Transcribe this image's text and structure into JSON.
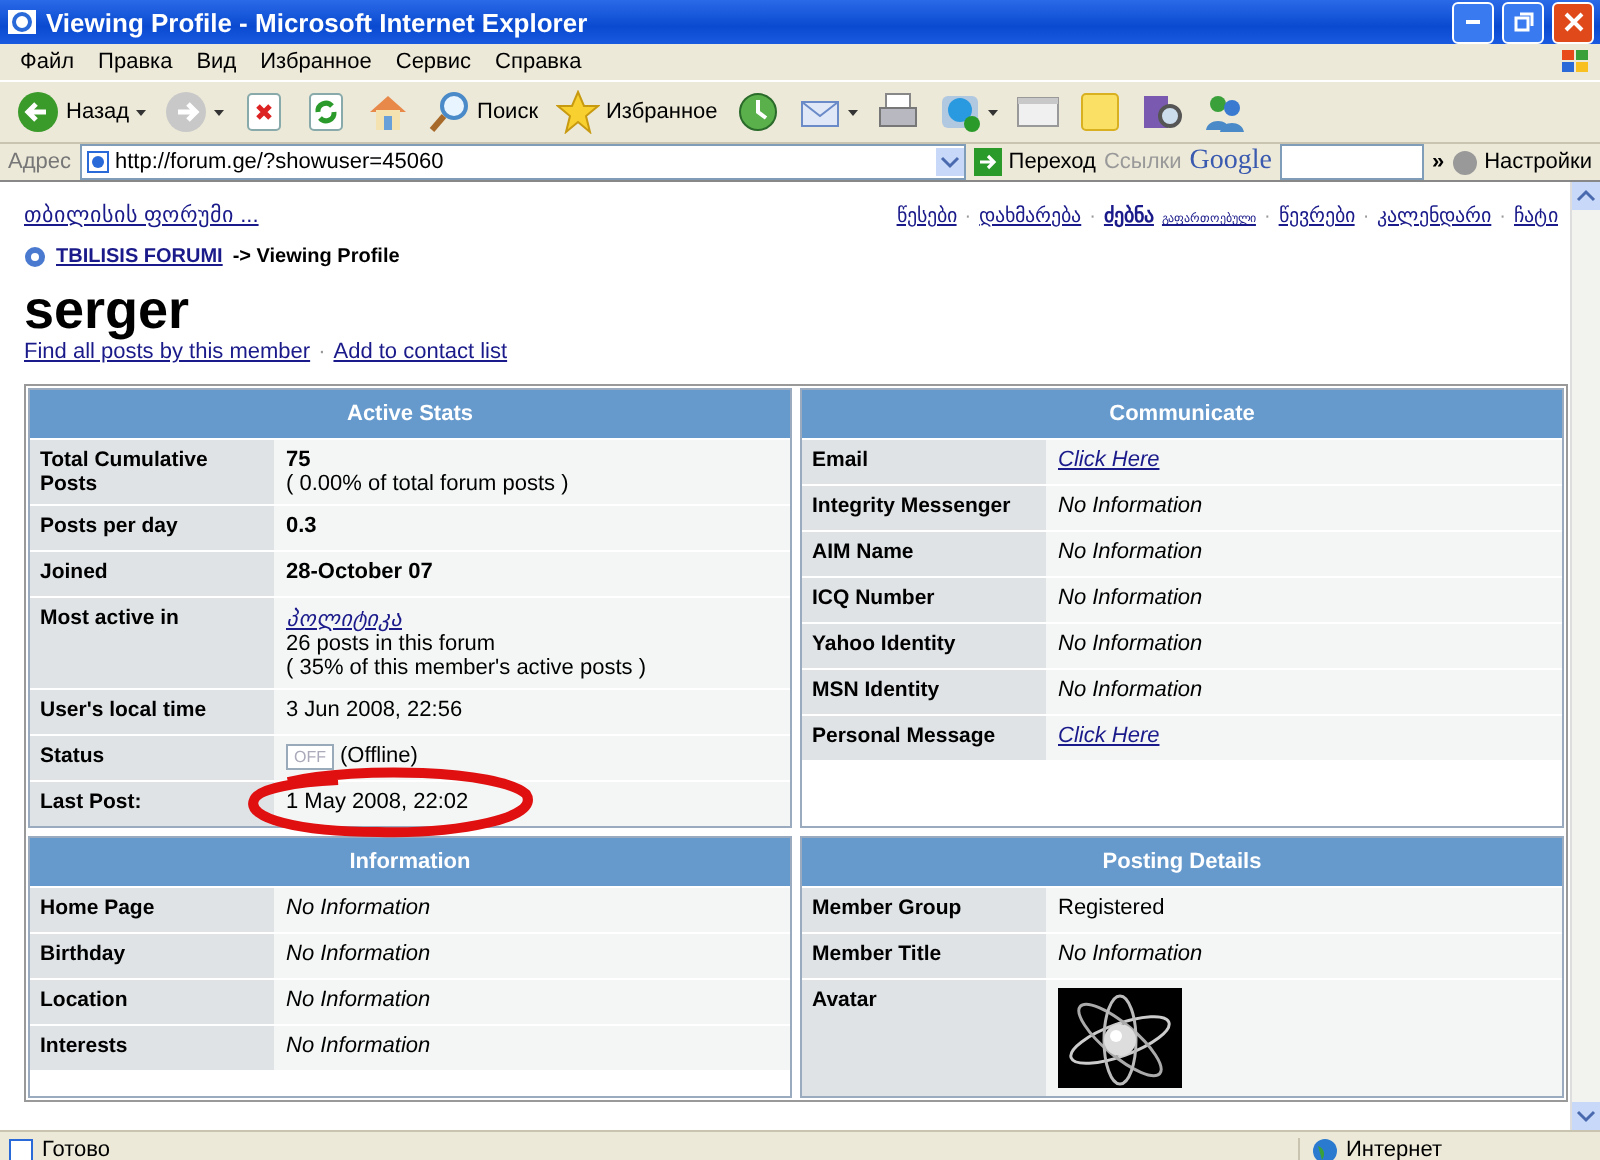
{
  "window": {
    "title": "Viewing Profile - Microsoft Internet Explorer"
  },
  "menu": [
    "Файл",
    "Правка",
    "Вид",
    "Избранное",
    "Сервис",
    "Справка"
  ],
  "toolbar": [
    {
      "kind": "back",
      "label": "Назад",
      "dropdown": true
    },
    {
      "kind": "forward",
      "dropdown": true
    },
    {
      "kind": "stop",
      "dropdown": false
    },
    {
      "kind": "refresh",
      "dropdown": false
    },
    {
      "kind": "home",
      "dropdown": false
    },
    {
      "kind": "search",
      "label": "Поиск",
      "dropdown": false
    },
    {
      "kind": "favorites",
      "label": "Избранное",
      "dropdown": false
    },
    {
      "kind": "history",
      "dropdown": false
    },
    {
      "kind": "mail",
      "dropdown": true
    },
    {
      "kind": "print",
      "dropdown": false
    },
    {
      "kind": "skype",
      "dropdown": true
    },
    {
      "kind": "window",
      "dropdown": false
    },
    {
      "kind": "note",
      "dropdown": false
    },
    {
      "kind": "research",
      "dropdown": false
    },
    {
      "kind": "messenger",
      "dropdown": false
    }
  ],
  "address": {
    "label": "Адрес",
    "url": "http://forum.ge/?showuser=45060",
    "go": "Переход",
    "links": "Ссылки",
    "search_brand": "Google",
    "more": "»",
    "settings": "Настройки"
  },
  "page": {
    "forum_link": "თბილისის ფორუმი ...",
    "separator": "·",
    "nav": [
      {
        "label": "წესები",
        "bold": false
      },
      {
        "label": "დახმარება",
        "bold": false
      },
      {
        "label": "ძებნა",
        "bold": true,
        "sup": "გაფართოებული"
      },
      {
        "label": "წევრები",
        "bold": false
      },
      {
        "label": "კალენდარი",
        "bold": false
      },
      {
        "label": "ჩატი",
        "bold": false
      }
    ],
    "breadcrumb": {
      "forum": "TBILISIS FORUMI",
      "rest": "-> Viewing Profile"
    },
    "username": "serger",
    "actions": [
      "Find all posts by this member",
      "Add to contact list"
    ],
    "panels": [
      {
        "title": "Active Stats",
        "rows": [
          {
            "label": "Total Cumulative Posts",
            "circled": false,
            "lines": [
              {
                "kind": "bold",
                "text": "75"
              },
              {
                "kind": "text",
                "text": "( 0.00% of total forum posts )"
              }
            ]
          },
          {
            "label": "Posts per day",
            "circled": false,
            "lines": [
              {
                "kind": "bold",
                "text": "0.3"
              }
            ]
          },
          {
            "label": "Joined",
            "circled": false,
            "lines": [
              {
                "kind": "bold",
                "text": "28-October 07"
              }
            ]
          },
          {
            "label": "Most active in",
            "circled": false,
            "lines": [
              {
                "kind": "link",
                "text": "პოლიტიკა"
              },
              {
                "kind": "text",
                "text": "26 posts in this forum"
              },
              {
                "kind": "text",
                "text": "( 35% of this member's active posts )"
              }
            ]
          },
          {
            "label": "User's local time",
            "circled": false,
            "lines": [
              {
                "kind": "text",
                "text": "3 Jun 2008, 22:56"
              }
            ]
          },
          {
            "label": "Status",
            "circled": false,
            "lines": [
              {
                "kind": "status",
                "badge": "OFF",
                "text": "(Offline)"
              }
            ]
          },
          {
            "label": "Last Post:",
            "circled": true,
            "lines": [
              {
                "kind": "text",
                "text": "1 May 2008, 22:02"
              }
            ]
          }
        ]
      },
      {
        "title": "Communicate",
        "rows": [
          {
            "label": "Email",
            "circled": false,
            "lines": [
              {
                "kind": "link",
                "text": "Click Here"
              }
            ]
          },
          {
            "label": "Integrity Messenger",
            "circled": false,
            "lines": [
              {
                "kind": "italic",
                "text": "No Information"
              }
            ]
          },
          {
            "label": "AIM Name",
            "circled": false,
            "lines": [
              {
                "kind": "italic",
                "text": "No Information"
              }
            ]
          },
          {
            "label": "ICQ Number",
            "circled": false,
            "lines": [
              {
                "kind": "italic",
                "text": "No Information"
              }
            ]
          },
          {
            "label": "Yahoo Identity",
            "circled": false,
            "lines": [
              {
                "kind": "italic",
                "text": "No Information"
              }
            ]
          },
          {
            "label": "MSN Identity",
            "circled": false,
            "lines": [
              {
                "kind": "italic",
                "text": "No Information"
              }
            ]
          },
          {
            "label": "Personal Message",
            "circled": false,
            "lines": [
              {
                "kind": "link",
                "text": "Click Here"
              }
            ]
          }
        ]
      },
      {
        "title": "Information",
        "rows": [
          {
            "label": "Home Page",
            "circled": false,
            "lines": [
              {
                "kind": "italic",
                "text": "No Information"
              }
            ]
          },
          {
            "label": "Birthday",
            "circled": false,
            "lines": [
              {
                "kind": "italic",
                "text": "No Information"
              }
            ]
          },
          {
            "label": "Location",
            "circled": false,
            "lines": [
              {
                "kind": "italic",
                "text": "No Information"
              }
            ]
          },
          {
            "label": "Interests",
            "circled": false,
            "lines": [
              {
                "kind": "italic",
                "text": "No Information"
              }
            ]
          }
        ]
      },
      {
        "title": "Posting Details",
        "rows": [
          {
            "label": "Member Group",
            "circled": false,
            "lines": [
              {
                "kind": "text",
                "text": "Registered"
              }
            ]
          },
          {
            "label": "Member Title",
            "circled": false,
            "lines": [
              {
                "kind": "italic",
                "text": "No Information"
              }
            ]
          },
          {
            "label": "Avatar",
            "circled": false
          }
        ]
      }
    ]
  },
  "status_bar": {
    "text": "Готово",
    "zone": "Интернет"
  }
}
